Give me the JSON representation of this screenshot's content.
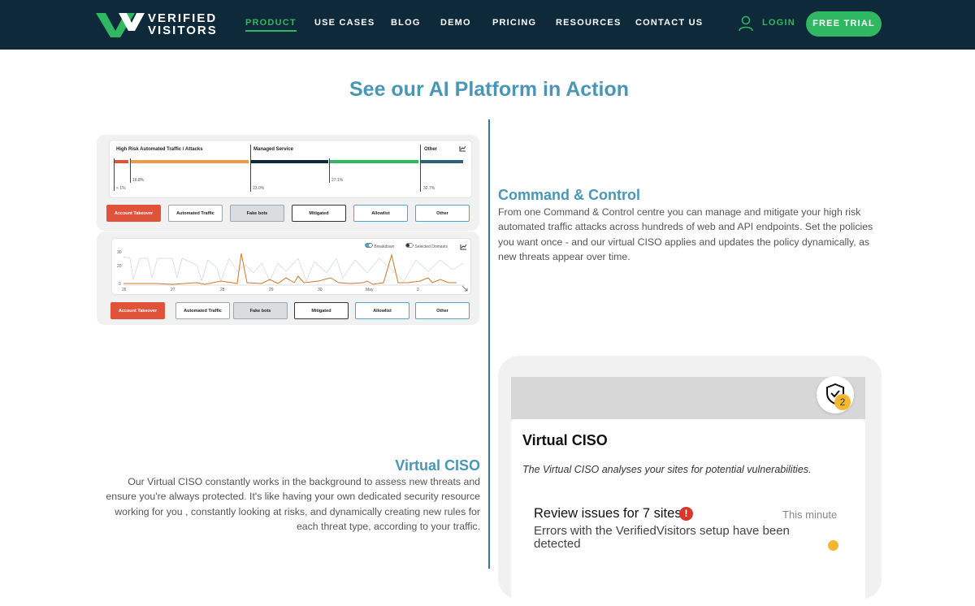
{
  "nav": {
    "logo_line1": "VERIFIED",
    "logo_line2": "VISITORS",
    "items": [
      "PRODUCT",
      "USE CASES",
      "BLOG",
      "DEMO",
      "PRICING",
      "RESOURCES",
      "CONTACT US"
    ],
    "login": "LOGIN",
    "cta": "FREE TRIAL"
  },
  "colors": {
    "navbar": "#0e2a3a",
    "accent_green": "#2fb761",
    "heading_blue": "#4996b6",
    "danger_red": "#e0523a"
  },
  "page_title": "See our AI Platform in Action",
  "dashboard": {
    "segments": [
      "High Risk Automated Traffic / Attacks",
      "Managed Service",
      "Other"
    ],
    "percentages": [
      "< 1%",
      "16.8%",
      "23.0%",
      "27.1%",
      "32.7%"
    ],
    "filters": [
      "Account Takeover",
      "Automated Traffic",
      "Fake bots",
      "Mitigated",
      "Allowlist",
      "Other"
    ],
    "toggles": [
      "Breakdown",
      "Selected Domains"
    ],
    "y_ticks": [
      "30",
      "20",
      "0"
    ],
    "x_ticks": [
      "26",
      "27",
      "28",
      "29",
      "30",
      "May",
      "2"
    ]
  },
  "command_control": {
    "heading": "Command & Control",
    "body": "From one Command & Control centre you can manage and mitigate your high risk automated traffic attacks across hundreds of web and API endpoints. Set the policies you want once - and our virtual CISO applies and updates the policy dynamically, as new threats appear over time."
  },
  "virtual_ciso": {
    "heading": "Virtual CISO",
    "body": "Our Virtual CISO constantly works in the background to assess new threats and ensure you're always protected. It's like having your own dedicated security resource working for you , constantly looking at risks, and dynamically creating new rules for each threat type, according to your traffic."
  },
  "phone": {
    "badge_count": "2",
    "title": "Virtual CISO",
    "subtitle": "The Virtual CISO analyses your sites for potential vulnerabilities.",
    "review_title": "Review issues for 7 sites",
    "warning_symbol": "!",
    "review_time": "This minute",
    "review_desc": "Errors with the VerifiedVisitors setup have been detected"
  }
}
